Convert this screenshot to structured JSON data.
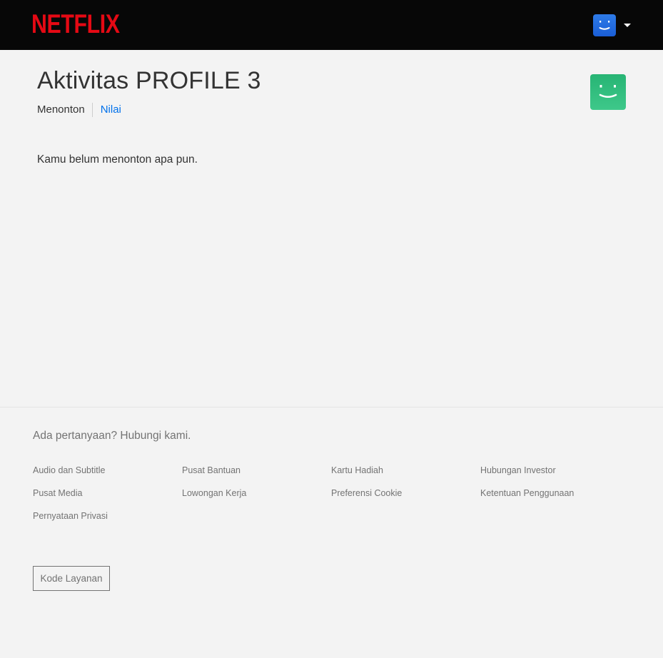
{
  "header": {
    "logo_text": "NETFLIX",
    "account_avatar_icon": "smiley-avatar-icon",
    "account_avatar_color": "#1a6fe0",
    "account_menu_icon": "caret-down-icon"
  },
  "main": {
    "title": "Aktivitas PROFILE 3",
    "profile_avatar_icon": "smiley-avatar-icon",
    "profile_avatar_color": "#2bb97a",
    "tabs": [
      {
        "label": "Menonton",
        "active": true
      },
      {
        "label": "Nilai",
        "active": false
      }
    ],
    "empty_message": "Kamu belum menonton apa pun."
  },
  "footer": {
    "contact_text": "Ada pertanyaan? Hubungi kami.",
    "links": [
      "Audio dan Subtitle",
      "Pusat Bantuan",
      "Kartu Hadiah",
      "Hubungan Investor",
      "Pusat Media",
      "Lowongan Kerja",
      "Preferensi Cookie",
      "Ketentuan Penggunaan",
      "Pernyataan Privasi"
    ],
    "service_code_label": "Kode Layanan"
  },
  "colors": {
    "brand_red": "#e50914",
    "link_blue": "#0071eb",
    "background": "#f3f3f3",
    "topbar": "#070707"
  }
}
